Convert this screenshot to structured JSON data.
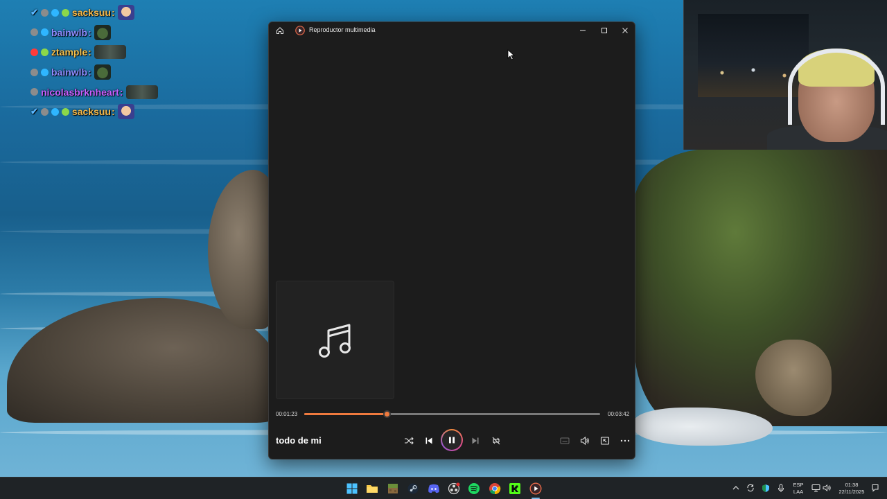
{
  "chat": {
    "messages": [
      {
        "user": "sacksuu",
        "color": "#f6b94a",
        "badges": [
          "tick",
          "gray",
          "blue",
          "green"
        ],
        "emote": "anime-face-emote"
      },
      {
        "user": "bainwlb",
        "color": "#8c8cff",
        "badges": [
          "gray",
          "blue"
        ],
        "emote": "frog-emote"
      },
      {
        "user": "ztample",
        "color": "#f5c04c",
        "badges": [
          "red",
          "green"
        ],
        "emote": "wide-emote"
      },
      {
        "user": "bainwlb",
        "color": "#8c8cff",
        "badges": [
          "gray",
          "blue"
        ],
        "emote": "frog-emote"
      },
      {
        "user": "nicolasbrknheart",
        "color": "#c760ff",
        "badges": [
          "gray"
        ],
        "emote": "wide-emote"
      },
      {
        "user": "sacksuu",
        "color": "#f6b94a",
        "badges": [
          "tick",
          "gray",
          "blue",
          "green"
        ],
        "emote": "anime-face-emote"
      }
    ],
    "colon": ":"
  },
  "player": {
    "window_title": "Reproductor multimedia",
    "track_title": "todo de mi",
    "current_time": "00:01:23",
    "total_time": "00:03:42",
    "progress": 0.28,
    "accent_color": "#ef7a3e",
    "album_art_icon": "music-note-icon"
  },
  "taskbar": {
    "apps": [
      "windows-start",
      "file-explorer",
      "minecraft",
      "steam",
      "discord",
      "obs",
      "spotify",
      "chrome",
      "kick",
      "media-player"
    ],
    "language": "ESP",
    "layout": "LAA",
    "time": "01:38",
    "date": "22/11/2025"
  }
}
